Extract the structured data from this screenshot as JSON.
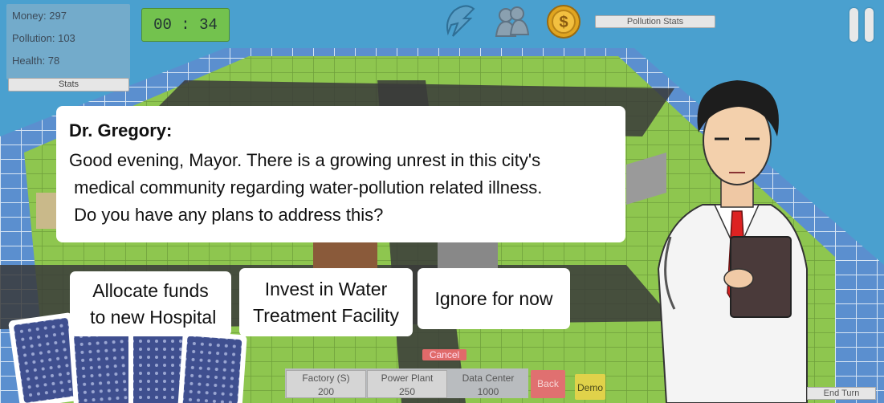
{
  "stats": {
    "money": "Money: 297",
    "pollution": "Pollution: 103",
    "health": "Health: 78",
    "stats_button": "Stats"
  },
  "timer": "00 : 34",
  "top_bar": {
    "icons": [
      "lightning-icon",
      "people-icon",
      "coin-icon"
    ],
    "pollution_stats_button": "Pollution Stats"
  },
  "dialog": {
    "speaker": "Dr. Gregory:",
    "message": "Good evening, Mayor. There is a growing unrest in this city's\n medical community regarding water-pollution related illness.\n Do you have any plans to address this?"
  },
  "choices": [
    {
      "label": "Allocate funds\n to new Hospital"
    },
    {
      "label": "Invest in Water\nTreatment Facility"
    },
    {
      "label": "Ignore for now"
    }
  ],
  "cancel_label": "Cancel",
  "shop": {
    "items": [
      {
        "name": "Factory (S)",
        "cost": "200"
      },
      {
        "name": "Power Plant",
        "cost": "250"
      },
      {
        "name": "Data Center",
        "cost": "1000"
      }
    ],
    "back_label": "Back",
    "demo_label": "Demo"
  },
  "end_turn_label": "End Turn",
  "colors": {
    "sky": "#4aa0cf",
    "timer_green": "#73c24e",
    "cancel_red": "#e06a6a",
    "demo_yellow": "#e0d24a"
  }
}
